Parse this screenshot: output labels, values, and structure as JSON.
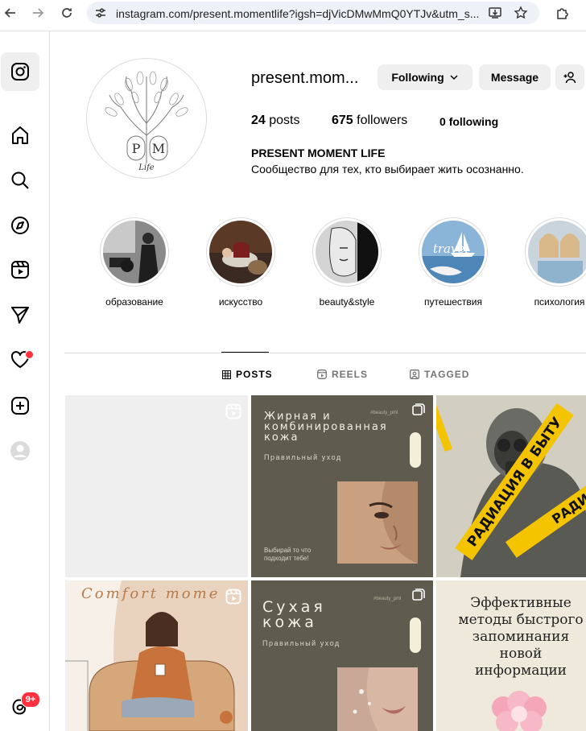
{
  "browser": {
    "url": "instagram.com/present.momentlife?igsh=djVicDMwMmQ0YTJv&utm_s..."
  },
  "rail": {
    "notification_count": "9+"
  },
  "profile": {
    "username": "present.mom...",
    "following_button": "Following",
    "message_button": "Message",
    "posts_count": "24",
    "posts_label": "posts",
    "followers_count": "675",
    "followers_label": "followers",
    "following_count": "0",
    "following_label": "following",
    "full_name": "PRESENT MOMENT LIFE",
    "bio": "Сообщество для тех, кто выбирает жить осознанно.",
    "avatar_letters": "P M",
    "avatar_script": "Life"
  },
  "highlights": [
    {
      "label": "образование"
    },
    {
      "label": "искусство"
    },
    {
      "label": "beauty&style"
    },
    {
      "label": "путешествия"
    },
    {
      "label": "психология"
    }
  ],
  "tabs": [
    {
      "label": "POSTS",
      "active": true
    },
    {
      "label": "REELS",
      "active": false
    },
    {
      "label": "TAGGED",
      "active": false
    }
  ],
  "posts": {
    "oily_skin": {
      "title_line1": "Жирная и",
      "title_line2": "комбинированная",
      "title_line3": "кожа",
      "subtitle": "Правильный уход",
      "footer_line1": "Выбирай то что",
      "footer_line2": "подходит тебе!",
      "tag": "#beauty_pml"
    },
    "radiation": {
      "tape_text": "РАДИАЦИЯ В БЫТУ"
    },
    "comfort": {
      "title": "Comfort mome"
    },
    "dry_skin": {
      "title_line1": "Сухая",
      "title_line2": "кожа",
      "subtitle": "Правильный уход",
      "tag": "#beauty_pml"
    },
    "memory": {
      "line1": "Эффективные",
      "line2": "методы быстрого",
      "line3": "запоминания",
      "line4": "новой",
      "line5": "информации"
    }
  },
  "colors": {
    "accent_red": "#ff3040",
    "button_gray": "#efefef",
    "olive_post": "#5f5b4e"
  }
}
